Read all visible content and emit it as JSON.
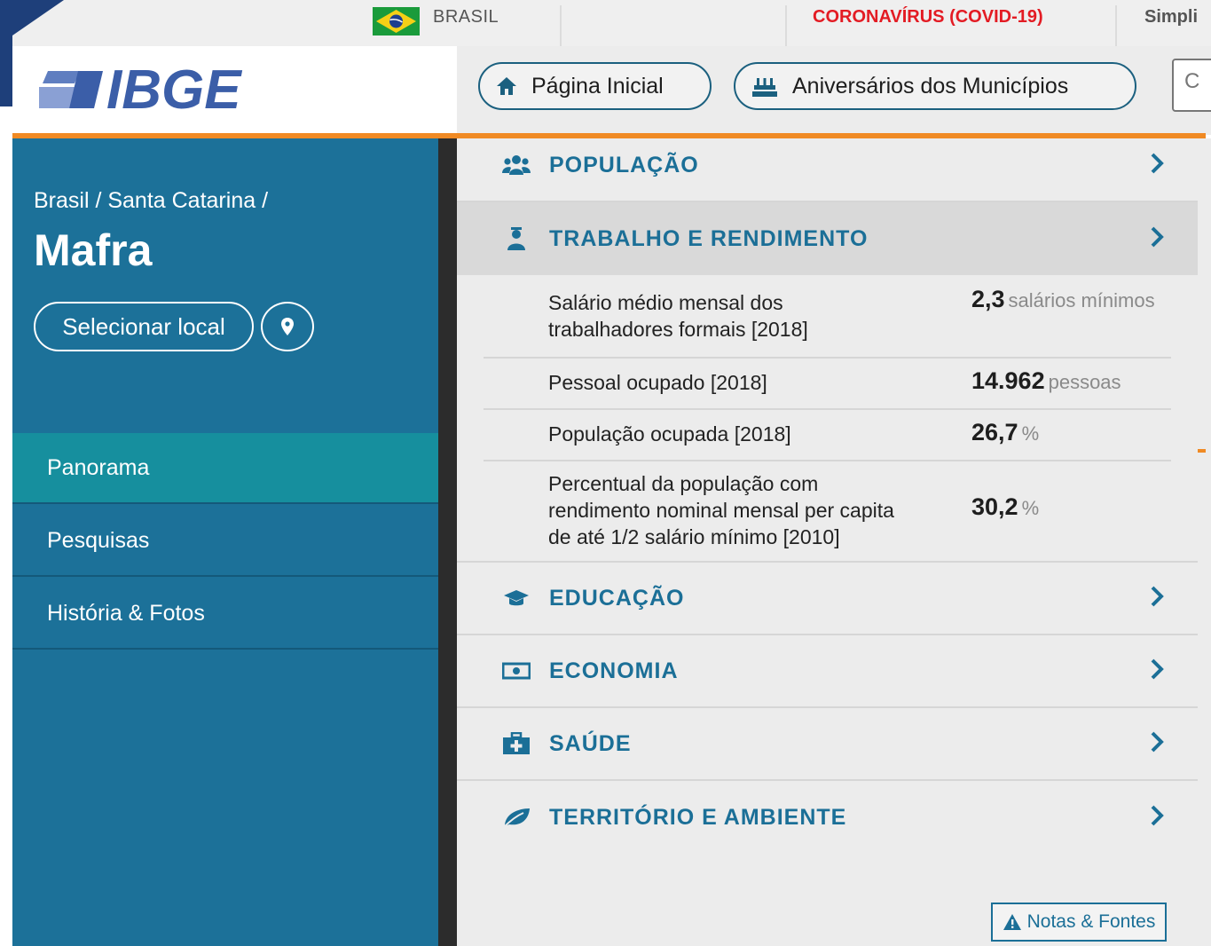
{
  "topbar": {
    "country": "BRASIL",
    "covid_link": "CORONAVÍRUS (COVID-19)",
    "simplifique": "Simpli"
  },
  "header": {
    "logo_text": "IBGE",
    "home_label": "Página Inicial",
    "anniversaries_label": "Aniversários dos Municípios",
    "search_placeholder": "C"
  },
  "sidebar": {
    "breadcrumb": "Brasil / Santa Catarina /",
    "city": "Mafra",
    "select_label": "Selecionar local",
    "items": [
      {
        "label": "Panorama",
        "active": true
      },
      {
        "label": "Pesquisas",
        "active": false
      },
      {
        "label": "História & Fotos",
        "active": false
      }
    ]
  },
  "categories": [
    {
      "label": "POPULAÇÃO",
      "icon": "people-icon"
    },
    {
      "label": "TRABALHO E RENDIMENTO",
      "icon": "worker-icon",
      "expanded": true
    },
    {
      "label": "EDUCAÇÃO",
      "icon": "graduation-cap-icon"
    },
    {
      "label": "ECONOMIA",
      "icon": "money-icon"
    },
    {
      "label": "SAÚDE",
      "icon": "medkit-icon"
    },
    {
      "label": "TERRITÓRIO E AMBIENTE",
      "icon": "leaf-icon"
    }
  ],
  "indicators": [
    {
      "label_line1": "Salário médio mensal dos",
      "label_line2": "trabalhadores formais [2018]",
      "value": "2,3",
      "unit": "salários mínimos"
    },
    {
      "label_line1": "Pessoal ocupado [2018]",
      "value": "14.962",
      "unit": "pessoas"
    },
    {
      "label_line1": "População ocupada [2018]",
      "value": "26,7",
      "unit": "%"
    },
    {
      "label_line1": "Percentual da população com",
      "label_line2": "rendimento nominal mensal per capita",
      "label_line3": "de até 1/2 salário mínimo [2010]",
      "value": "30,2",
      "unit": "%"
    }
  ],
  "footer": {
    "notes_label": "Notas & Fontes"
  },
  "colors": {
    "sidebar": "#1c7199",
    "active_nav": "#168f9e",
    "accent_orange": "#f08a24",
    "category_text": "#1b6f97",
    "covid_red": "#e31b23"
  }
}
